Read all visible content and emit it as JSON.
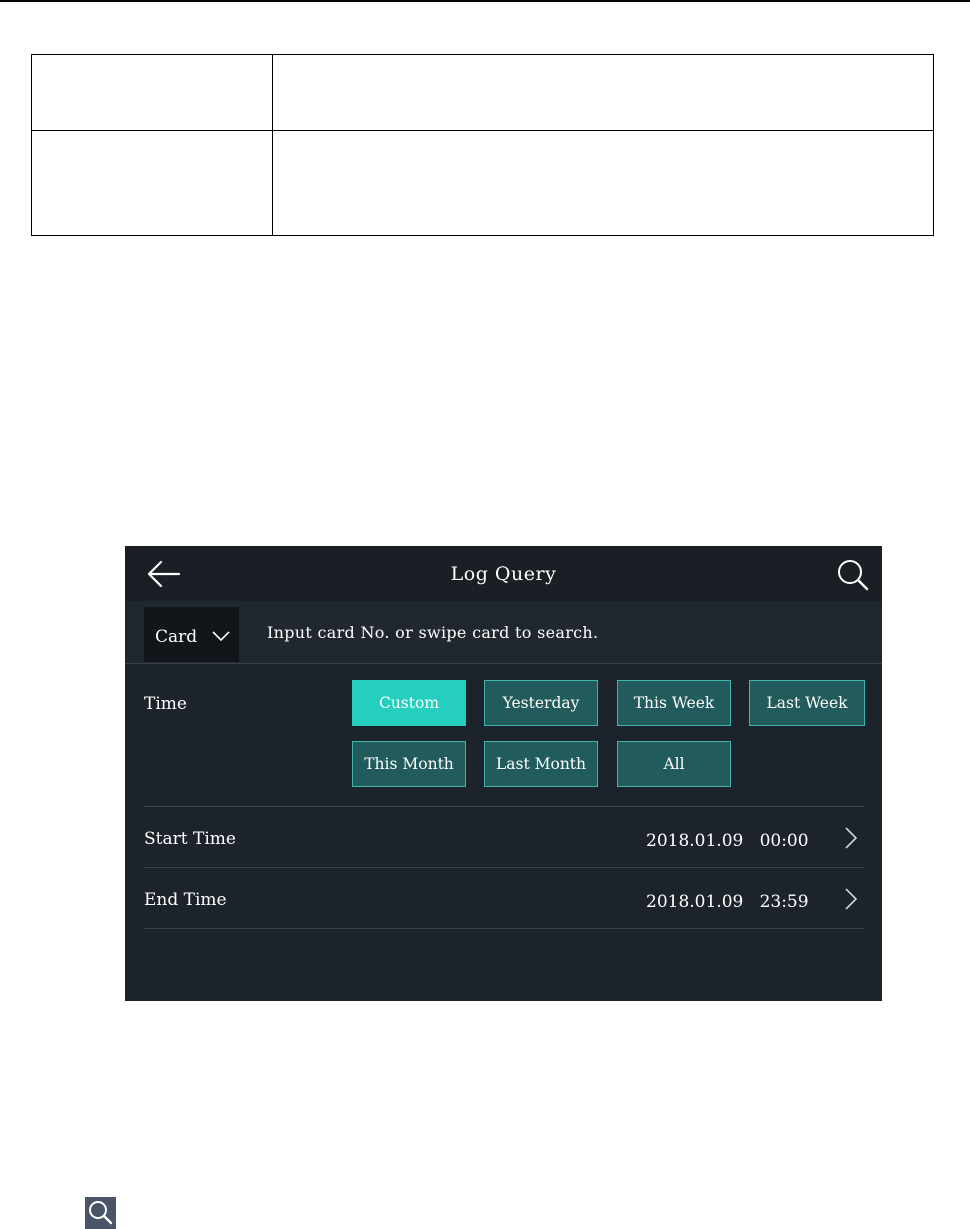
{
  "document": {
    "table": {
      "rows": [
        [
          "",
          ""
        ],
        [
          "",
          ""
        ]
      ]
    }
  },
  "screen": {
    "title": "Log Query",
    "search_type": "Card",
    "search_placeholder": "Input card No. or swipe card to search.",
    "time_label": "Time",
    "time_options": [
      "Custom",
      "Yesterday",
      "This Week",
      "Last Week",
      "This Month",
      "Last Month",
      "All"
    ],
    "selected_time_option": "Custom",
    "start_time": {
      "label": "Start Time",
      "date": "2018.01.09",
      "time": "00:00"
    },
    "end_time": {
      "label": "End Time",
      "date": "2018.01.09",
      "time": "23:59"
    }
  },
  "icons": [
    "arrow-left",
    "search",
    "chevron-down",
    "chevron-right",
    "search"
  ],
  "colors": {
    "screen_background": "#1d232a",
    "button_active": "#25cfc0",
    "button_inactive": "#215b5b",
    "button_border": "#3fb5ad"
  }
}
